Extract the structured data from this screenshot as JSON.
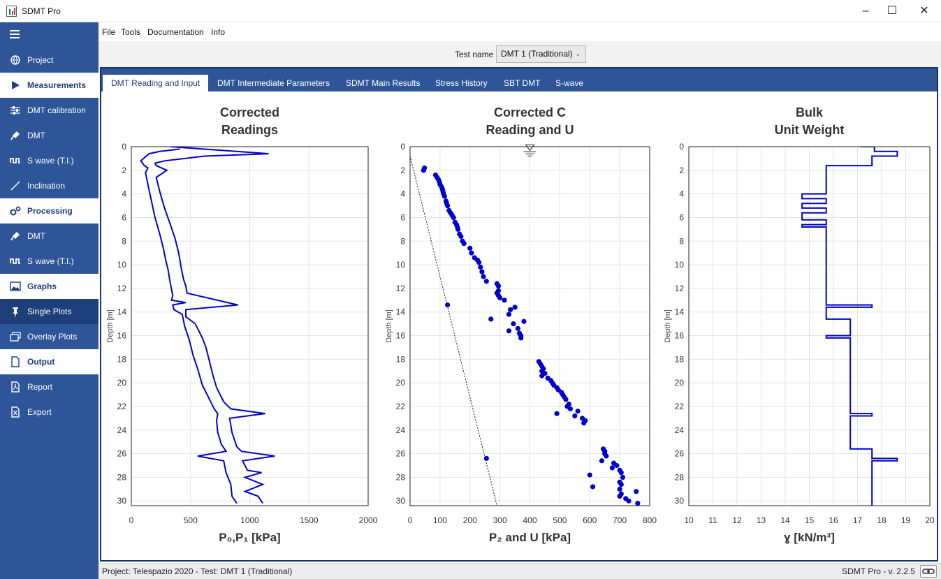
{
  "app": {
    "title": "SDMT Pro"
  },
  "menu": [
    "File",
    "Tools",
    "Documentation",
    "Info"
  ],
  "test_selector": {
    "label": "Test name",
    "value": "DMT 1 (Traditional)"
  },
  "sidebar": {
    "items": [
      {
        "label": "Project",
        "icon": "globe-icon",
        "kind": "item"
      },
      {
        "label": "Measurements",
        "icon": "play-icon",
        "kind": "section"
      },
      {
        "label": "DMT calibration",
        "icon": "sliders-icon",
        "kind": "item"
      },
      {
        "label": "DMT",
        "icon": "paddle-icon",
        "kind": "item"
      },
      {
        "label": "S wave (T.I.)",
        "icon": "wave-icon",
        "kind": "item"
      },
      {
        "label": "Inclination",
        "icon": "slash-icon",
        "kind": "item"
      },
      {
        "label": "Processing",
        "icon": "gears-icon",
        "kind": "section"
      },
      {
        "label": "DMT",
        "icon": "paddle-icon",
        "kind": "item"
      },
      {
        "label": "S wave (T.I.)",
        "icon": "wave-icon",
        "kind": "item"
      },
      {
        "label": "Graphs",
        "icon": "image-icon",
        "kind": "section"
      },
      {
        "label": "Single Plots",
        "icon": "pin-icon",
        "kind": "active"
      },
      {
        "label": "Overlay Plots",
        "icon": "layers-icon",
        "kind": "item"
      },
      {
        "label": "Output",
        "icon": "file-icon",
        "kind": "section"
      },
      {
        "label": "Report",
        "icon": "pdf-icon",
        "kind": "item"
      },
      {
        "label": "Export",
        "icon": "excel-icon",
        "kind": "item"
      }
    ]
  },
  "tabs": [
    "DMT Reading and Input",
    "DMT Intermediate Parameters",
    "SDMT Main Results",
    "Stress History",
    "SBT DMT",
    "S-wave"
  ],
  "selected_tab": 0,
  "status": {
    "left": "Project: Telespazio 2020 - Test: DMT 1 (Traditional)",
    "right": "SDMT Pro - v. 2.2.5"
  },
  "colors": {
    "sidebar": "#2d5597",
    "accent": "#1f3c78",
    "series": "#0000cd"
  },
  "chart_data": [
    {
      "type": "line",
      "title_lines": [
        "Corrected",
        "Readings"
      ],
      "xlabel": "P₀,P₁ [kPa]",
      "ylabel": "Depth [m]",
      "xlim": [
        0,
        2000
      ],
      "xticks": [
        0,
        500,
        1000,
        1500,
        2000
      ],
      "ylim": [
        30.4,
        0
      ],
      "yticks": [
        0,
        2,
        4,
        6,
        8,
        10,
        12,
        14,
        16,
        18,
        20,
        22,
        24,
        26,
        28,
        30
      ],
      "grid": true,
      "series": [
        {
          "values": [
            [
              410,
              0.2
            ],
            [
              240,
              0.4
            ],
            [
              150,
              0.6
            ],
            [
              80,
              1.2
            ],
            [
              110,
              1.6
            ],
            [
              140,
              1.8
            ],
            [
              120,
              2.2
            ],
            [
              140,
              3.2
            ],
            [
              170,
              4.6
            ],
            [
              200,
              6.0
            ],
            [
              240,
              7.4
            ],
            [
              270,
              8.6
            ],
            [
              290,
              9.6
            ],
            [
              310,
              10.4
            ],
            [
              330,
              11.6
            ],
            [
              350,
              12.6
            ],
            [
              340,
              13.0
            ],
            [
              460,
              13.2
            ],
            [
              350,
              13.4
            ],
            [
              360,
              13.8
            ],
            [
              430,
              14.2
            ],
            [
              450,
              15.2
            ],
            [
              490,
              16.4
            ],
            [
              520,
              17.6
            ],
            [
              560,
              18.8
            ],
            [
              600,
              20.2
            ],
            [
              650,
              21.2
            ],
            [
              700,
              22.2
            ],
            [
              730,
              22.6
            ],
            [
              720,
              23.2
            ],
            [
              730,
              24.2
            ],
            [
              760,
              25.2
            ],
            [
              800,
              25.8
            ],
            [
              560,
              26.2
            ],
            [
              780,
              26.6
            ],
            [
              800,
              27.6
            ],
            [
              840,
              28.6
            ],
            [
              850,
              29.6
            ],
            [
              890,
              30.2
            ]
          ]
        },
        {
          "values": [
            [
              330,
              0.0
            ],
            [
              1160,
              0.6
            ],
            [
              620,
              0.8
            ],
            [
              280,
              1.2
            ],
            [
              200,
              1.4
            ],
            [
              210,
              1.6
            ],
            [
              300,
              2.0
            ],
            [
              210,
              2.6
            ],
            [
              240,
              3.8
            ],
            [
              280,
              5.2
            ],
            [
              330,
              6.6
            ],
            [
              370,
              7.8
            ],
            [
              400,
              9.0
            ],
            [
              420,
              10.2
            ],
            [
              440,
              11.2
            ],
            [
              460,
              11.8
            ],
            [
              470,
              12.4
            ],
            [
              900,
              13.4
            ],
            [
              460,
              13.8
            ],
            [
              460,
              14.4
            ],
            [
              540,
              15.0
            ],
            [
              600,
              16.2
            ],
            [
              630,
              17.0
            ],
            [
              660,
              18.2
            ],
            [
              690,
              19.4
            ],
            [
              720,
              20.4
            ],
            [
              780,
              21.6
            ],
            [
              840,
              22.2
            ],
            [
              1130,
              22.6
            ],
            [
              830,
              23.0
            ],
            [
              850,
              24.2
            ],
            [
              890,
              25.4
            ],
            [
              930,
              25.8
            ],
            [
              1210,
              26.2
            ],
            [
              940,
              26.6
            ],
            [
              980,
              27.4
            ],
            [
              1100,
              27.6
            ],
            [
              960,
              28.0
            ],
            [
              1110,
              28.6
            ],
            [
              960,
              29.2
            ],
            [
              1070,
              29.6
            ],
            [
              1110,
              30.2
            ]
          ]
        }
      ]
    },
    {
      "type": "scatter",
      "title_lines": [
        "Corrected C",
        "Reading and U"
      ],
      "xlabel": "P₂ and U [kPa]",
      "ylabel": "Depth [m]",
      "xlim": [
        0,
        800
      ],
      "xticks": [
        0,
        100,
        200,
        300,
        400,
        500,
        600,
        700,
        800
      ],
      "ylim": [
        30.4,
        0
      ],
      "yticks": [
        0,
        2,
        4,
        6,
        8,
        10,
        12,
        14,
        16,
        18,
        20,
        22,
        24,
        26,
        28,
        30
      ],
      "grid": true,
      "water_table": {
        "x": 400,
        "y": 0.2
      },
      "hydrostatic_line": [
        [
          0,
          0.8
        ],
        [
          290,
          30.4
        ]
      ],
      "series": [
        {
          "values": [
            [
              45,
              2.0
            ],
            [
              48,
              1.8
            ],
            [
              85,
              2.4
            ],
            [
              90,
              2.6
            ],
            [
              95,
              2.8
            ],
            [
              98,
              3.0
            ],
            [
              100,
              3.2
            ],
            [
              105,
              3.4
            ],
            [
              108,
              3.6
            ],
            [
              110,
              3.8
            ],
            [
              112,
              4.0
            ],
            [
              115,
              4.2
            ],
            [
              120,
              4.6
            ],
            [
              122,
              4.8
            ],
            [
              125,
              5.0
            ],
            [
              130,
              5.4
            ],
            [
              135,
              5.6
            ],
            [
              140,
              5.8
            ],
            [
              145,
              6.0
            ],
            [
              150,
              6.4
            ],
            [
              155,
              6.6
            ],
            [
              158,
              6.8
            ],
            [
              160,
              7.0
            ],
            [
              165,
              7.4
            ],
            [
              170,
              7.6
            ],
            [
              175,
              8.0
            ],
            [
              180,
              8.2
            ],
            [
              200,
              8.6
            ],
            [
              205,
              9.0
            ],
            [
              215,
              9.4
            ],
            [
              225,
              9.6
            ],
            [
              230,
              9.8
            ],
            [
              235,
              10.2
            ],
            [
              240,
              10.6
            ],
            [
              245,
              11.0
            ],
            [
              255,
              11.4
            ],
            [
              290,
              11.6
            ],
            [
              295,
              11.8
            ],
            [
              295,
              12.2
            ],
            [
              290,
              12.4
            ],
            [
              295,
              12.6
            ],
            [
              300,
              12.8
            ],
            [
              315,
              13.0
            ],
            [
              350,
              13.6
            ],
            [
              335,
              13.8
            ],
            [
              330,
              14.2
            ],
            [
              380,
              14.8
            ],
            [
              345,
              15.0
            ],
            [
              360,
              15.4
            ],
            [
              330,
              15.6
            ],
            [
              365,
              15.8
            ],
            [
              370,
              16.0
            ],
            [
              370,
              16.2
            ],
            [
              270,
              14.6
            ],
            [
              125,
              13.4
            ],
            [
              430,
              18.2
            ],
            [
              435,
              18.4
            ],
            [
              440,
              18.6
            ],
            [
              445,
              18.8
            ],
            [
              440,
              19.0
            ],
            [
              450,
              19.2
            ],
            [
              440,
              19.4
            ],
            [
              460,
              19.6
            ],
            [
              470,
              19.8
            ],
            [
              475,
              20.0
            ],
            [
              480,
              20.2
            ],
            [
              490,
              20.4
            ],
            [
              495,
              20.6
            ],
            [
              505,
              20.8
            ],
            [
              510,
              21.0
            ],
            [
              515,
              21.2
            ],
            [
              520,
              21.4
            ],
            [
              530,
              21.8
            ],
            [
              525,
              22.0
            ],
            [
              535,
              22.2
            ],
            [
              490,
              22.6
            ],
            [
              560,
              22.4
            ],
            [
              550,
              22.8
            ],
            [
              575,
              23.0
            ],
            [
              585,
              23.2
            ],
            [
              580,
              23.4
            ],
            [
              645,
              25.6
            ],
            [
              650,
              25.8
            ],
            [
              650,
              26.0
            ],
            [
              655,
              26.2
            ],
            [
              640,
              26.6
            ],
            [
              680,
              26.8
            ],
            [
              690,
              27.0
            ],
            [
              675,
              27.2
            ],
            [
              700,
              27.4
            ],
            [
              705,
              27.6
            ],
            [
              710,
              28.0
            ],
            [
              600,
              27.8
            ],
            [
              700,
              28.4
            ],
            [
              705,
              28.6
            ],
            [
              700,
              29.0
            ],
            [
              610,
              28.8
            ],
            [
              705,
              29.4
            ],
            [
              700,
              29.6
            ],
            [
              720,
              29.8
            ],
            [
              730,
              30.0
            ],
            [
              755,
              29.2
            ],
            [
              760,
              30.2
            ],
            [
              255,
              26.4
            ]
          ]
        }
      ]
    },
    {
      "type": "line",
      "title_lines": [
        "Bulk",
        "Unit Weight"
      ],
      "xlabel": "ɣ [kN/m³]",
      "ylabel": "Depth [m]",
      "xlim": [
        10,
        20
      ],
      "xticks": [
        10,
        11,
        12,
        13,
        14,
        15,
        16,
        17,
        18,
        19,
        20
      ],
      "ylim": [
        30.4,
        0
      ],
      "yticks": [
        0,
        2,
        4,
        6,
        8,
        10,
        12,
        14,
        16,
        18,
        20,
        22,
        24,
        26,
        28,
        30
      ],
      "grid": true,
      "series": [
        {
          "values": [
            [
              17.1,
              0.0
            ],
            [
              17.7,
              0.0
            ],
            [
              17.7,
              0.4
            ],
            [
              18.65,
              0.4
            ],
            [
              18.65,
              0.8
            ],
            [
              17.6,
              0.8
            ],
            [
              17.6,
              1.6
            ],
            [
              15.7,
              1.6
            ],
            [
              15.7,
              4.0
            ],
            [
              14.7,
              4.0
            ],
            [
              14.7,
              4.4
            ],
            [
              15.7,
              4.4
            ],
            [
              15.7,
              4.8
            ],
            [
              14.7,
              4.8
            ],
            [
              14.7,
              5.2
            ],
            [
              15.7,
              5.2
            ],
            [
              15.7,
              5.6
            ],
            [
              14.7,
              5.6
            ],
            [
              14.7,
              6.2
            ],
            [
              15.7,
              6.2
            ],
            [
              15.7,
              6.6
            ],
            [
              14.7,
              6.6
            ],
            [
              14.7,
              6.8
            ],
            [
              15.7,
              6.8
            ],
            [
              15.7,
              13.4
            ],
            [
              17.6,
              13.4
            ],
            [
              17.6,
              13.6
            ],
            [
              15.7,
              13.6
            ],
            [
              15.7,
              14.6
            ],
            [
              16.7,
              14.6
            ],
            [
              16.7,
              16.0
            ],
            [
              15.7,
              16.0
            ],
            [
              15.7,
              16.2
            ],
            [
              16.7,
              16.2
            ],
            [
              16.7,
              22.6
            ],
            [
              17.6,
              22.6
            ],
            [
              17.6,
              22.8
            ],
            [
              16.7,
              22.8
            ],
            [
              16.7,
              25.6
            ],
            [
              17.6,
              25.6
            ],
            [
              17.6,
              26.4
            ],
            [
              18.65,
              26.4
            ],
            [
              18.65,
              26.6
            ],
            [
              17.6,
              26.6
            ],
            [
              17.6,
              30.4
            ]
          ]
        }
      ]
    }
  ]
}
